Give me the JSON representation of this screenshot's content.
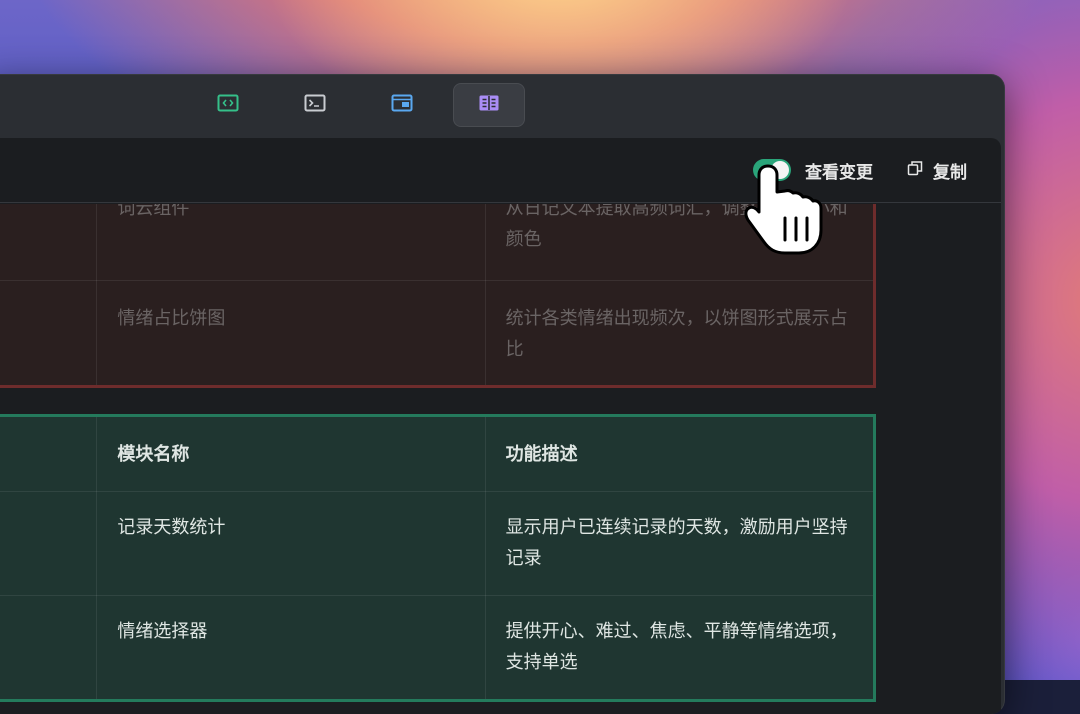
{
  "toolbar": {
    "buttons": [
      {
        "name": "code-view",
        "icon": "code-icon",
        "color": "#35c08a",
        "active": false
      },
      {
        "name": "terminal-view",
        "icon": "terminal-icon",
        "color": "#c9ccd1",
        "active": false
      },
      {
        "name": "preview-view",
        "icon": "window-icon",
        "color": "#5aa8f0",
        "active": false
      },
      {
        "name": "diff-view",
        "icon": "split-panel-icon",
        "color": "#a98df5",
        "active": true
      }
    ]
  },
  "header": {
    "view_changes_label": "查看变更",
    "view_changes_on": true,
    "copy_label": "复制"
  },
  "removed_table": {
    "rows": [
      {
        "name": "",
        "module": "词云组件",
        "description": "从日记文本提取高频词汇，调整字体大小和颜色"
      },
      {
        "name": "",
        "module": "情绪占比饼图",
        "description": "统计各类情绪出现频次，以饼图形式展示占比"
      }
    ]
  },
  "added_table": {
    "header": {
      "col1": "",
      "module": "模块名称",
      "description": "功能描述"
    },
    "rows": [
      {
        "name": "",
        "module": "记录天数统计",
        "description": "显示用户已连续记录的天数，激励用户坚持记录"
      },
      {
        "name": "",
        "module": "情绪选择器",
        "description": "提供开心、难过、焦虑、平静等情绪选项，支持单选"
      }
    ]
  },
  "colors": {
    "removed_border": "#6e2c2c",
    "added_border": "#247a5c",
    "toggle_on": "#2aa57a"
  }
}
